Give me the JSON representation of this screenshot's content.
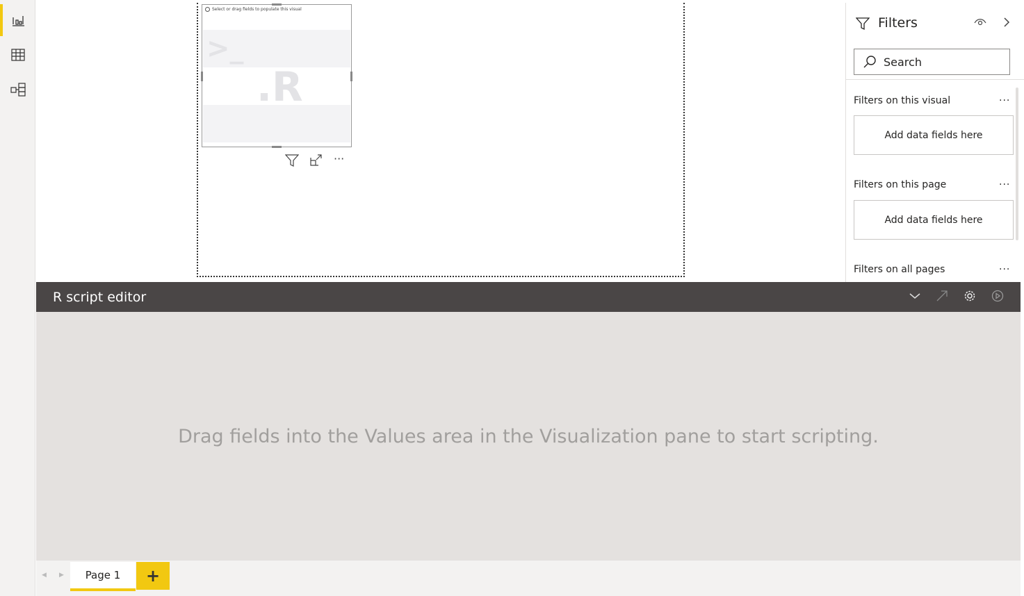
{
  "sidebar": {
    "items": [
      {
        "icon": "report-icon",
        "active": true
      },
      {
        "icon": "data-icon"
      },
      {
        "icon": "model-icon"
      }
    ]
  },
  "visual": {
    "hint": "Select or drag fields to populate this visual",
    "placeholder_text": ".R",
    "prompt": ">_"
  },
  "filters": {
    "title": "Filters",
    "search_placeholder": "Search",
    "sections": [
      {
        "label": "Filters on this visual",
        "drop": "Add data fields here"
      },
      {
        "label": "Filters on this page",
        "drop": "Add data fields here"
      },
      {
        "label": "Filters on all pages"
      }
    ],
    "more": "···"
  },
  "editor": {
    "title": "R script editor",
    "message": "Drag fields into the Values area in the Visualization pane to start scripting."
  },
  "pages": {
    "tabs": [
      {
        "label": "Page 1",
        "active": true
      }
    ],
    "add": "+"
  },
  "colors": {
    "accent": "#f2c811",
    "editor_bar": "#4a4646"
  }
}
